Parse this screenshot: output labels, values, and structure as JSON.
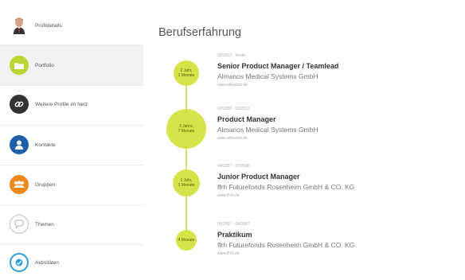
{
  "sidebar": {
    "items": [
      {
        "label": "Profildetails",
        "icon": "avatar-icon"
      },
      {
        "label": "Portfolio",
        "icon": "folder-icon"
      },
      {
        "label": "Weitere Profile im Netz",
        "icon": "link-icon"
      },
      {
        "label": "Kontakte",
        "icon": "person-icon"
      },
      {
        "label": "Gruppen",
        "icon": "group-icon"
      },
      {
        "label": "Themen",
        "icon": "chat-icon"
      },
      {
        "label": "Aktivitäten",
        "icon": "activity-icon"
      }
    ]
  },
  "main": {
    "title": "Berufserfahrung",
    "entries": [
      {
        "bubble_line1": "2 Jahr,",
        "bubble_line2": "2 Monate",
        "date": "02/2012 - heute",
        "job": "Senior Product Manager / Teamlead",
        "company": "Almanos Medical Systems GmbH",
        "url": "www.almanos.de"
      },
      {
        "bubble_line1": "3 Jahre,",
        "bubble_line2": "7 Monate",
        "date": "07/2008 - 02/2012",
        "job": "Product Manager",
        "company": "Almanos Medical Systems GmbH",
        "url": "www.almanos.de"
      },
      {
        "bubble_line1": "1 Jahr,",
        "bubble_line2": "3 Monate",
        "date": "04/2007 - 07/2008",
        "job": "Junior Product Manager",
        "company": "ffrh Futurefonds Rosenheim GmbH & CO. KG",
        "url": "www.ff-rh.de"
      },
      {
        "bubble_line1": "",
        "bubble_line2": "4 Monate",
        "date": "01/2007 - 04/2007",
        "job": "Praktikum",
        "company": "ffrh Futurefonds Rosenheim GmbH & CO. KG",
        "url": "www.ff-rh.de"
      }
    ]
  },
  "colors": {
    "accent": "#d4e34a",
    "timeline": "#cfe27a",
    "active_nav": "#f2f2f2"
  }
}
